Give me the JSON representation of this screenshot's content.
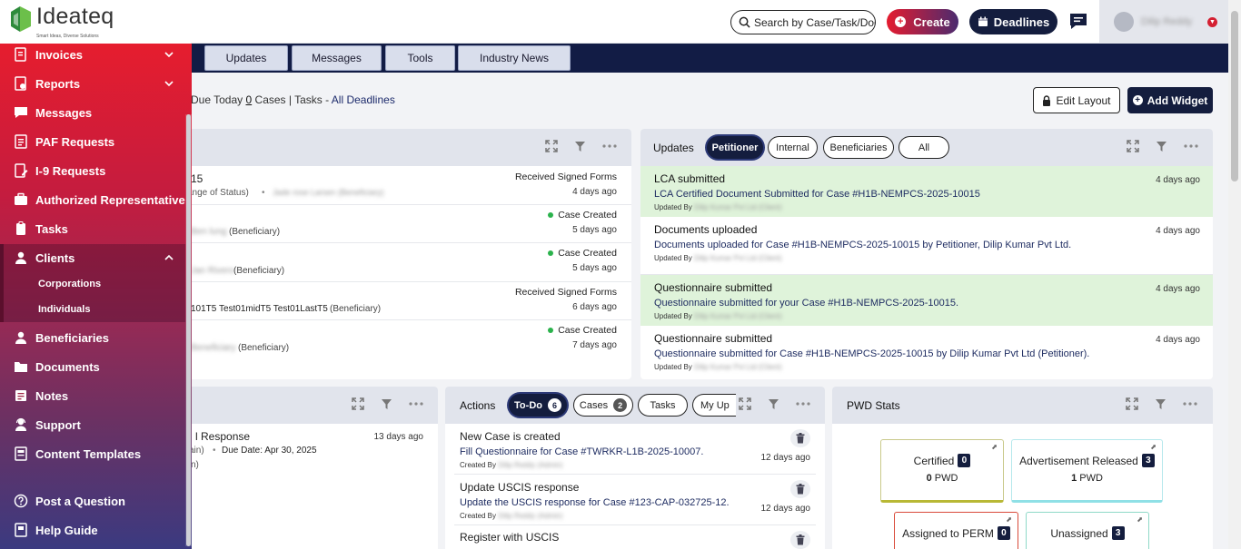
{
  "brand": {
    "name": "Ideateq",
    "tagline": "Smart Ideas, Diverse Solutions"
  },
  "header": {
    "search_placeholder": "Search by Case/Task/Docu",
    "create_label": "Create",
    "deadlines_label": "Deadlines",
    "user_name": "Dilip Reddy"
  },
  "tabs": [
    "Updates",
    "Messages",
    "Tools",
    "Industry News"
  ],
  "summary": {
    "prefix": "Due Today ",
    "cases_count": "0",
    "cases_suffix": " Cases | Tasks - ",
    "link": "All Deadlines"
  },
  "toolbar": {
    "edit_layout": "Edit Layout",
    "add_widget": "Add Widget"
  },
  "cases_widget": {
    "rows": [
      {
        "line1": "15",
        "line2": "ange of Status)",
        "line2b": "Jade rose Larsen (Beneficiary)",
        "status": "Received Signed Forms",
        "dot": false,
        "time": "4 days ago"
      },
      {
        "line1": "",
        "line2blur": "Ben lung",
        "line2": " (Beneficiary)",
        "status": "Case Created",
        "dot": true,
        "time": "5 days ago"
      },
      {
        "line1": "",
        "line2blur": "Jan Rivero",
        "line2": " (Beneficiary)",
        "status": "Case Created",
        "dot": true,
        "time": "5 days ago"
      },
      {
        "line1": "",
        "line2": "101T5 Test01midT5 Test01LastT5",
        "line2c": " (Beneficiary)",
        "status": "Received Signed Forms",
        "dot": false,
        "time": "6 days ago"
      },
      {
        "line1": "",
        "line2blur": "Beneficiary",
        "line2": " (Beneficiary)",
        "status": "Case Created",
        "dot": true,
        "time": "7 days ago"
      }
    ]
  },
  "updates_widget": {
    "title": "Updates",
    "filters": [
      "Petitioner",
      "Internal",
      "Beneficiaries",
      "All"
    ],
    "rows": [
      {
        "title": "LCA submitted",
        "desc": "LCA Certified Document Submitted for Case #H1B-NEMPCS-2025-10015",
        "by": "Updated By",
        "by_name": "Dilip Kumar Pvt Ltd (Client)",
        "time": "4 days ago",
        "green": true
      },
      {
        "title": "Documents uploaded",
        "desc": "Documents uploaded for Case #H1B-NEMPCS-2025-10015 by Petitioner, Dilip Kumar Pvt Ltd.",
        "by": "Updated By",
        "by_name": "Dilip Kumar Pvt Ltd (Client)",
        "time": "4 days ago",
        "green": false
      },
      {
        "title": "Questionnaire submitted",
        "desc": "Questionnaire submitted for your Case #H1B-NEMPCS-2025-10015.",
        "by": "Updated By",
        "by_name": "Dilip Kumar Pvt Ltd (Client)",
        "time": "4 days ago",
        "green": true
      },
      {
        "title": "Questionnaire submitted",
        "desc": "Questionnaire submitted for Case #H1B-NEMPCS-2025-10015 by Dilip Kumar Pvt Ltd (Petitioner).",
        "by": "Updated By",
        "by_name": "Dilip Kumar Pvt Ltd (Client)",
        "time": "4 days ago",
        "green": false
      }
    ]
  },
  "rfe_widget": {
    "row": {
      "title": "l Response",
      "sub1": "ain)",
      "due": "Due Date: Apr 30, 2025",
      "sub2": "n)",
      "time": "13 days ago"
    }
  },
  "actions_widget": {
    "title": "Actions",
    "filters": [
      {
        "label": "To-Do",
        "count": "6"
      },
      {
        "label": "Cases",
        "count": "2"
      },
      {
        "label": "Tasks",
        "count": ""
      },
      {
        "label": "My Up",
        "count": ""
      }
    ],
    "rows": [
      {
        "title": "New Case is created",
        "desc": "Fill Questionnaire for Case #TWRKR-L1B-2025-10007.",
        "by": "Created By",
        "by_name": "Dilip Reddy (Admin)",
        "time": "12 days ago"
      },
      {
        "title": "Update USCIS response",
        "desc": "Update the USCIS response for Case #123-CAP-032725-12.",
        "by": "Created By",
        "by_name": "Dilip Reddy (Admin)",
        "time": "12 days ago"
      },
      {
        "title": "Register with USCIS",
        "desc": "",
        "by": "",
        "by_name": "",
        "time": ""
      }
    ]
  },
  "pwd_widget": {
    "title": "PWD Stats",
    "stats": [
      {
        "label": "Certified",
        "count": "0",
        "sub_n": "0",
        "sub": "PWD",
        "color": "#b8b835"
      },
      {
        "label": "Advertisement Released",
        "count": "3",
        "sub_n": "1",
        "sub": "PWD",
        "color": "#8fe0e6"
      },
      {
        "label": "Assigned to PERM",
        "count": "0",
        "sub_n": "",
        "sub": "",
        "color": "#d94a3a"
      },
      {
        "label": "Unassigned",
        "count": "3",
        "sub_n": "",
        "sub": "",
        "color": "#8fd9c8"
      }
    ]
  },
  "sidebar": {
    "items": [
      {
        "label": "Invoices",
        "icon": "invoice-icon",
        "chevron": "down"
      },
      {
        "label": "Reports",
        "icon": "report-icon",
        "chevron": "down"
      },
      {
        "label": "Messages",
        "icon": "message-icon",
        "chevron": ""
      },
      {
        "label": "PAF Requests",
        "icon": "document-icon",
        "chevron": ""
      },
      {
        "label": "I-9 Requests",
        "icon": "edit-doc-icon",
        "chevron": ""
      },
      {
        "label": "Authorized Representative",
        "icon": "briefcase-icon",
        "chevron": ""
      },
      {
        "label": "Tasks",
        "icon": "clipboard-icon",
        "chevron": ""
      },
      {
        "label": "Clients",
        "icon": "person-icon",
        "chevron": "up"
      },
      {
        "label": "Beneficiaries",
        "icon": "person-icon",
        "chevron": ""
      },
      {
        "label": "Documents",
        "icon": "folder-icon",
        "chevron": ""
      },
      {
        "label": "Notes",
        "icon": "notes-icon",
        "chevron": ""
      },
      {
        "label": "Support",
        "icon": "support-icon",
        "chevron": ""
      },
      {
        "label": "Content Templates",
        "icon": "template-icon",
        "chevron": ""
      }
    ],
    "sub_items": [
      "Corporations",
      "Individuals"
    ],
    "footer": [
      {
        "label": "Post a Question",
        "icon": "question-icon"
      },
      {
        "label": "Help Guide",
        "icon": "book-icon"
      }
    ]
  },
  "colors": {
    "navy": "#141d3e",
    "red": "#e51b2f",
    "green_row": "#dff3da"
  }
}
